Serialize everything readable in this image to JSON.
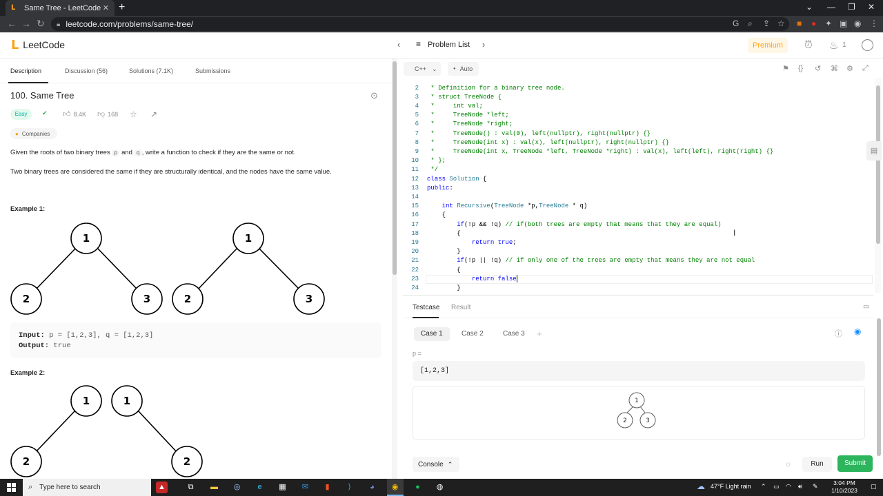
{
  "browser": {
    "tab_title": "Same Tree - LeetCode",
    "url": "leetcode.com/problems/same-tree/"
  },
  "header": {
    "logo_text": "LeetCode",
    "problem_list": "Problem List",
    "premium": "Premium",
    "streak_count": "1"
  },
  "left": {
    "tabs": [
      {
        "label": "Description"
      },
      {
        "label": "Discussion (56)"
      },
      {
        "label": "Solutions (7.1K)"
      },
      {
        "label": "Submissions"
      }
    ],
    "title": "100. Same Tree",
    "difficulty": "Easy",
    "likes": "8.4K",
    "dislikes": "168",
    "companies": "Companies",
    "desc1_a": "Given the roots of two binary trees ",
    "desc1_p": "p",
    "desc1_b": " and ",
    "desc1_q": "q",
    "desc1_c": ", write a function to check if they are the same or not.",
    "desc2": "Two binary trees are considered the same if they are structurally identical, and the nodes have the same value.",
    "example1_heading": "Example 1:",
    "example1_input_label": "Input:",
    "example1_input_value": "p = [1,2,3], q = [1,2,3]",
    "example1_output_label": "Output:",
    "example1_output_value": "true",
    "example2_heading": "Example 2:",
    "tree_nodes": {
      "a": "1",
      "b": "2",
      "c": "3"
    }
  },
  "editor": {
    "language": "C++",
    "mode": "Auto",
    "lines": [
      {
        "n": "2",
        "segs": [
          [
            "cm",
            " * Definition for a binary tree node."
          ]
        ]
      },
      {
        "n": "3",
        "segs": [
          [
            "cm",
            " * struct TreeNode {"
          ]
        ]
      },
      {
        "n": "4",
        "segs": [
          [
            "cm",
            " *     int val;"
          ]
        ]
      },
      {
        "n": "5",
        "segs": [
          [
            "cm",
            " *     TreeNode *left;"
          ]
        ]
      },
      {
        "n": "6",
        "segs": [
          [
            "cm",
            " *     TreeNode *right;"
          ]
        ]
      },
      {
        "n": "7",
        "segs": [
          [
            "cm",
            " *     TreeNode() : val(0), left(nullptr), right(nullptr) {}"
          ]
        ]
      },
      {
        "n": "8",
        "segs": [
          [
            "cm",
            " *     TreeNode(int x) : val(x), left(nullptr), right(nullptr) {}"
          ]
        ]
      },
      {
        "n": "9",
        "segs": [
          [
            "cm",
            " *     TreeNode(int x, TreeNode *left, TreeNode *right) : val(x), left(left), right(right) {}"
          ]
        ]
      },
      {
        "n": "10",
        "segs": [
          [
            "cm",
            " * };"
          ]
        ]
      },
      {
        "n": "11",
        "segs": [
          [
            "cm",
            " */"
          ]
        ]
      },
      {
        "n": "12",
        "segs": [
          [
            "kw",
            "class "
          ],
          [
            "ty",
            "Solution"
          ],
          [
            "tx",
            " {"
          ]
        ]
      },
      {
        "n": "13",
        "segs": [
          [
            "kw",
            "public"
          ],
          [
            "tx",
            ":"
          ]
        ]
      },
      {
        "n": "14",
        "segs": []
      },
      {
        "n": "15",
        "segs": [
          [
            "tx",
            "    "
          ],
          [
            "kw",
            "int "
          ],
          [
            "ty",
            "Recursive"
          ],
          [
            "tx",
            "("
          ],
          [
            "ty",
            "TreeNode"
          ],
          [
            "tx",
            " *p,"
          ],
          [
            "ty",
            "TreeNode"
          ],
          [
            "tx",
            " * q)"
          ]
        ]
      },
      {
        "n": "16",
        "segs": [
          [
            "tx",
            "    {"
          ]
        ]
      },
      {
        "n": "17",
        "segs": [
          [
            "tx",
            "        "
          ],
          [
            "kw",
            "if"
          ],
          [
            "tx",
            "(!p && !q) "
          ],
          [
            "cm",
            "// if(both trees are empty that means that they are equal)"
          ]
        ]
      },
      {
        "n": "18",
        "segs": [
          [
            "tx",
            "        {"
          ]
        ]
      },
      {
        "n": "19",
        "segs": [
          [
            "tx",
            "            "
          ],
          [
            "kw",
            "return "
          ],
          [
            "kw",
            "true"
          ],
          [
            "tx",
            ";"
          ]
        ]
      },
      {
        "n": "20",
        "segs": [
          [
            "tx",
            "        }"
          ]
        ]
      },
      {
        "n": "21",
        "segs": [
          [
            "tx",
            "        "
          ],
          [
            "kw",
            "if"
          ],
          [
            "tx",
            "(!p || !q) "
          ],
          [
            "cm",
            "// if only one of the trees are empty that means they are not equal"
          ]
        ]
      },
      {
        "n": "22",
        "segs": [
          [
            "tx",
            "        {"
          ]
        ]
      },
      {
        "n": "23",
        "segs": [
          [
            "tx",
            "            "
          ],
          [
            "kw",
            "return "
          ],
          [
            "kw",
            "false"
          ]
        ]
      },
      {
        "n": "24",
        "segs": [
          [
            "tx",
            "        }"
          ]
        ]
      }
    ]
  },
  "testpanel": {
    "tabs": [
      {
        "label": "Testcase"
      },
      {
        "label": "Result"
      }
    ],
    "cases": [
      {
        "label": "Case 1"
      },
      {
        "label": "Case 2"
      },
      {
        "label": "Case 3"
      }
    ],
    "add": "+",
    "p_label": "p =",
    "p_value": "[1,2,3]",
    "console": "Console",
    "run": "Run",
    "submit": "Submit"
  },
  "taskbar": {
    "search_placeholder": "Type here to search",
    "weather": "47°F  Light rain",
    "time": "3:04 PM",
    "date": "1/10/2023"
  },
  "colors": {
    "brand": "#ffa116",
    "easy": "#00af9b",
    "submit": "#2db55d"
  }
}
